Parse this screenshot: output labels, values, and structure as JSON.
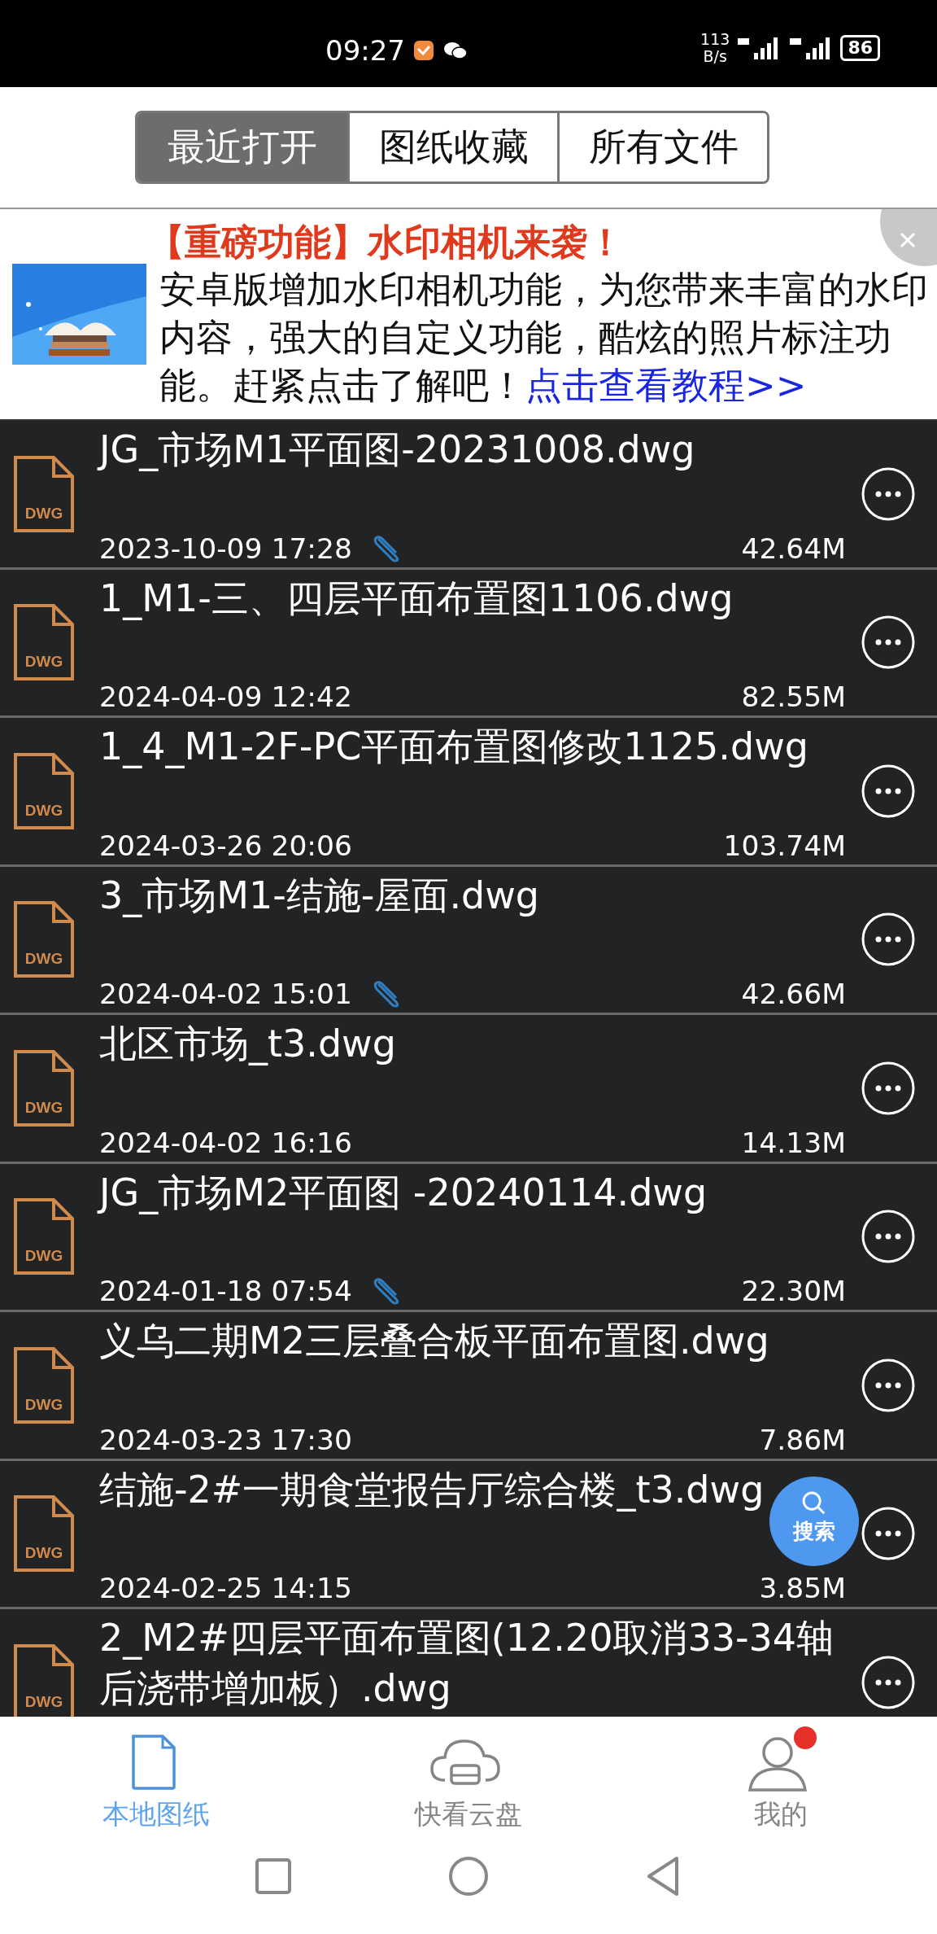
{
  "status_bar": {
    "time": "09:27",
    "net_speed": "113",
    "net_unit": "B/s",
    "battery": "86"
  },
  "tabs": [
    {
      "label": "最近打开",
      "selected": true
    },
    {
      "label": "图纸收藏",
      "selected": false
    },
    {
      "label": "所有文件",
      "selected": false
    }
  ],
  "banner": {
    "title": "【重磅功能】水印相机来袭！",
    "text": "安卓版增加水印相机功能，为您带来丰富的水印内容，强大的自定义功能，酷炫的照片标注功能。赶紧点击了解吧！",
    "link": "点击查看教程>>"
  },
  "files": [
    {
      "name": "JG_市场M1平面图-20231008.dwg",
      "icon_label": "DWG",
      "date": "2023-10-09 17:28",
      "size": "42.64M",
      "attached": true
    },
    {
      "name": "1_M1-三、四层平面布置图1106.dwg",
      "icon_label": "DWG",
      "date": "2024-04-09 12:42",
      "size": "82.55M",
      "attached": false
    },
    {
      "name": "1_4_M1-2F-PC平面布置图修改1125.dwg",
      "icon_label": "DWG",
      "date": "2024-03-26 20:06",
      "size": "103.74M",
      "attached": false
    },
    {
      "name": "3_市场M1-结施-屋面.dwg",
      "icon_label": "DWG",
      "date": "2024-04-02 15:01",
      "size": "42.66M",
      "attached": true
    },
    {
      "name": "北区市场_t3.dwg",
      "icon_label": "DWG",
      "date": "2024-04-02 16:16",
      "size": "14.13M",
      "attached": false
    },
    {
      "name": "JG_市场M2平面图 -20240114.dwg",
      "icon_label": "DWG",
      "date": "2024-01-18 07:54",
      "size": "22.30M",
      "attached": true
    },
    {
      "name": "义乌二期M2三层叠合板平面布置图.dwg",
      "icon_label": "DWG",
      "date": "2024-03-23 17:30",
      "size": "7.86M",
      "attached": false
    },
    {
      "name": "结施-2#一期食堂报告厅综合楼_t3.dwg",
      "icon_label": "DWG",
      "date": "2024-02-25 14:15",
      "size": "3.85M",
      "attached": false
    },
    {
      "name": "2_M2#四层平面布置图(12.20取消33-34轴后浇带增加板）.dwg",
      "icon_label": "DWG",
      "attached": false
    }
  ],
  "search_button": "搜索",
  "bottom_nav": [
    {
      "label": "本地图纸",
      "kind": "file",
      "selected": true,
      "notification": false
    },
    {
      "label": "快看云盘",
      "kind": "cloud",
      "selected": false,
      "notification": false
    },
    {
      "label": "我的",
      "kind": "person",
      "selected": false,
      "notification": true
    }
  ]
}
